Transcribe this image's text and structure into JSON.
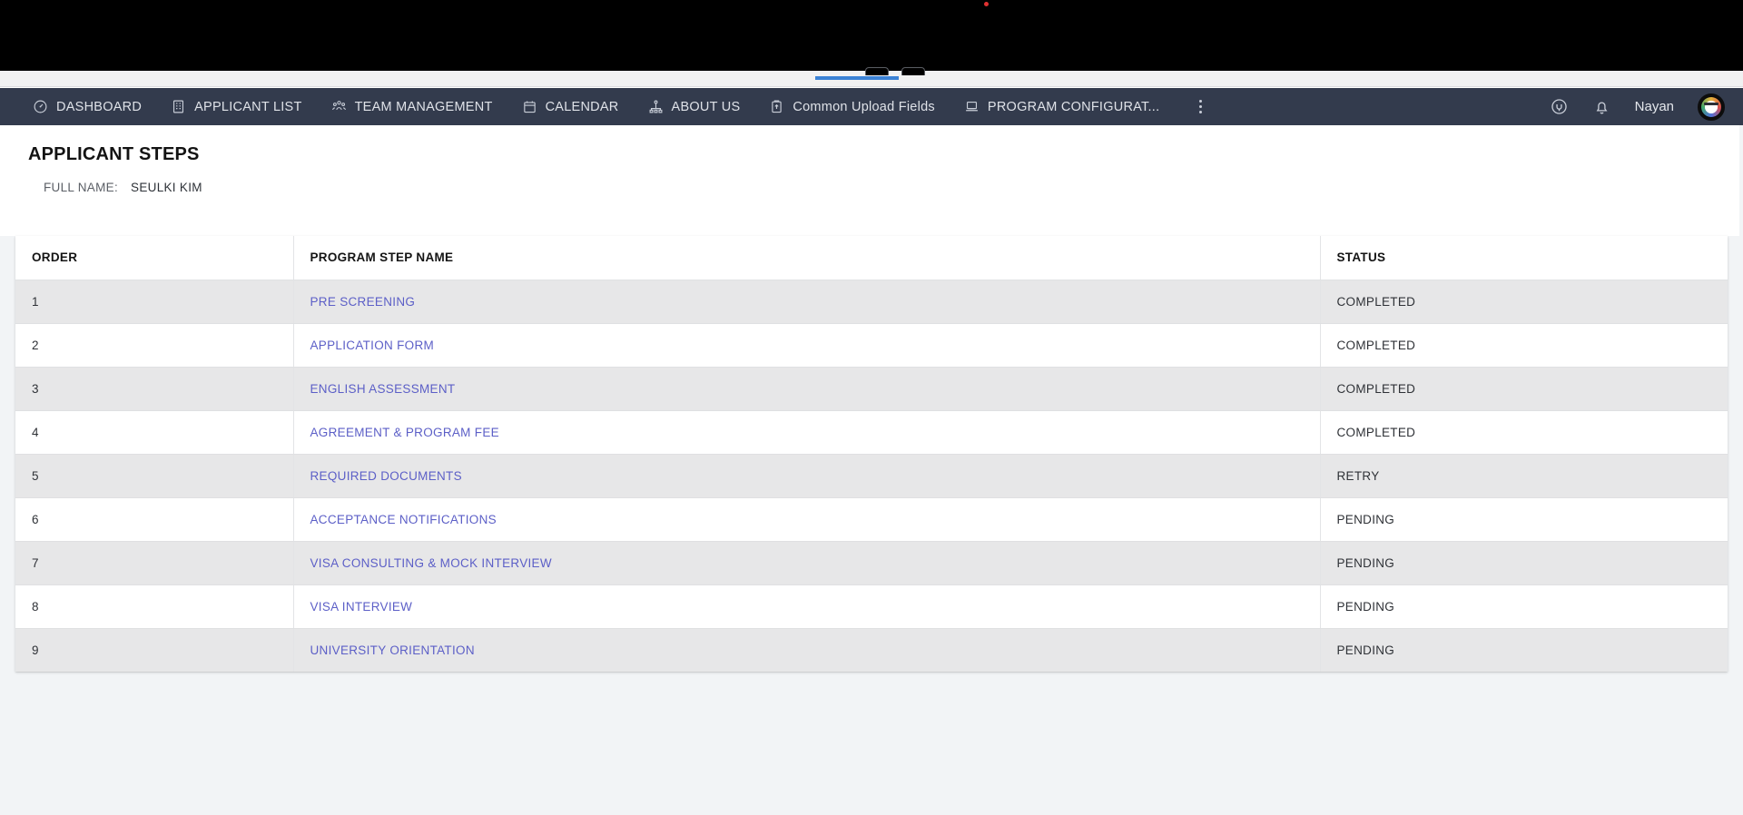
{
  "browser": {
    "recording_dot": "red-dot"
  },
  "navbar": {
    "items": [
      {
        "label": "DASHBOARD",
        "icon": "speedometer-icon"
      },
      {
        "label": "APPLICANT LIST",
        "icon": "list-document-icon"
      },
      {
        "label": "TEAM MANAGEMENT",
        "icon": "people-group-icon"
      },
      {
        "label": "CALENDAR",
        "icon": "calendar-icon"
      },
      {
        "label": "ABOUT US",
        "icon": "org-chart-icon"
      },
      {
        "label": "Common Upload Fields",
        "icon": "clipboard-upload-icon"
      },
      {
        "label": "PROGRAM CONFIGURAT...",
        "icon": "laptop-icon"
      }
    ],
    "overflow_icon": "kebab-menu-icon",
    "power_icon": "power-plug-icon",
    "bell_icon": "notification-bell-icon",
    "user_name": "Nayan",
    "avatar_icon": "user-avatar"
  },
  "main": {
    "title": "APPLICANT STEPS",
    "full_name_label": "FULL NAME:",
    "full_name_value": "SEULKI KIM",
    "table": {
      "columns": [
        "ORDER",
        "PROGRAM STEP NAME",
        "STATUS"
      ],
      "rows": [
        {
          "order": "1",
          "step": "PRE SCREENING",
          "status": "COMPLETED"
        },
        {
          "order": "2",
          "step": "APPLICATION FORM",
          "status": "COMPLETED"
        },
        {
          "order": "3",
          "step": "ENGLISH ASSESSMENT",
          "status": "COMPLETED"
        },
        {
          "order": "4",
          "step": "AGREEMENT & PROGRAM FEE",
          "status": "COMPLETED"
        },
        {
          "order": "5",
          "step": "REQUIRED DOCUMENTS",
          "status": "RETRY"
        },
        {
          "order": "6",
          "step": "ACCEPTANCE NOTIFICATIONS",
          "status": "PENDING"
        },
        {
          "order": "7",
          "step": "VISA CONSULTING & MOCK INTERVIEW",
          "status": "PENDING"
        },
        {
          "order": "8",
          "step": "VISA INTERVIEW",
          "status": "PENDING"
        },
        {
          "order": "9",
          "step": "UNIVERSITY ORIENTATION",
          "status": "PENDING"
        }
      ]
    }
  },
  "colors": {
    "nav_background": "#333b4d",
    "nav_text": "#dfe2e8",
    "link": "#5c5fc7",
    "page_background": "#f2f4f6",
    "row_alt": "#e7e7e8",
    "tab_accent": "#3b82d6"
  }
}
